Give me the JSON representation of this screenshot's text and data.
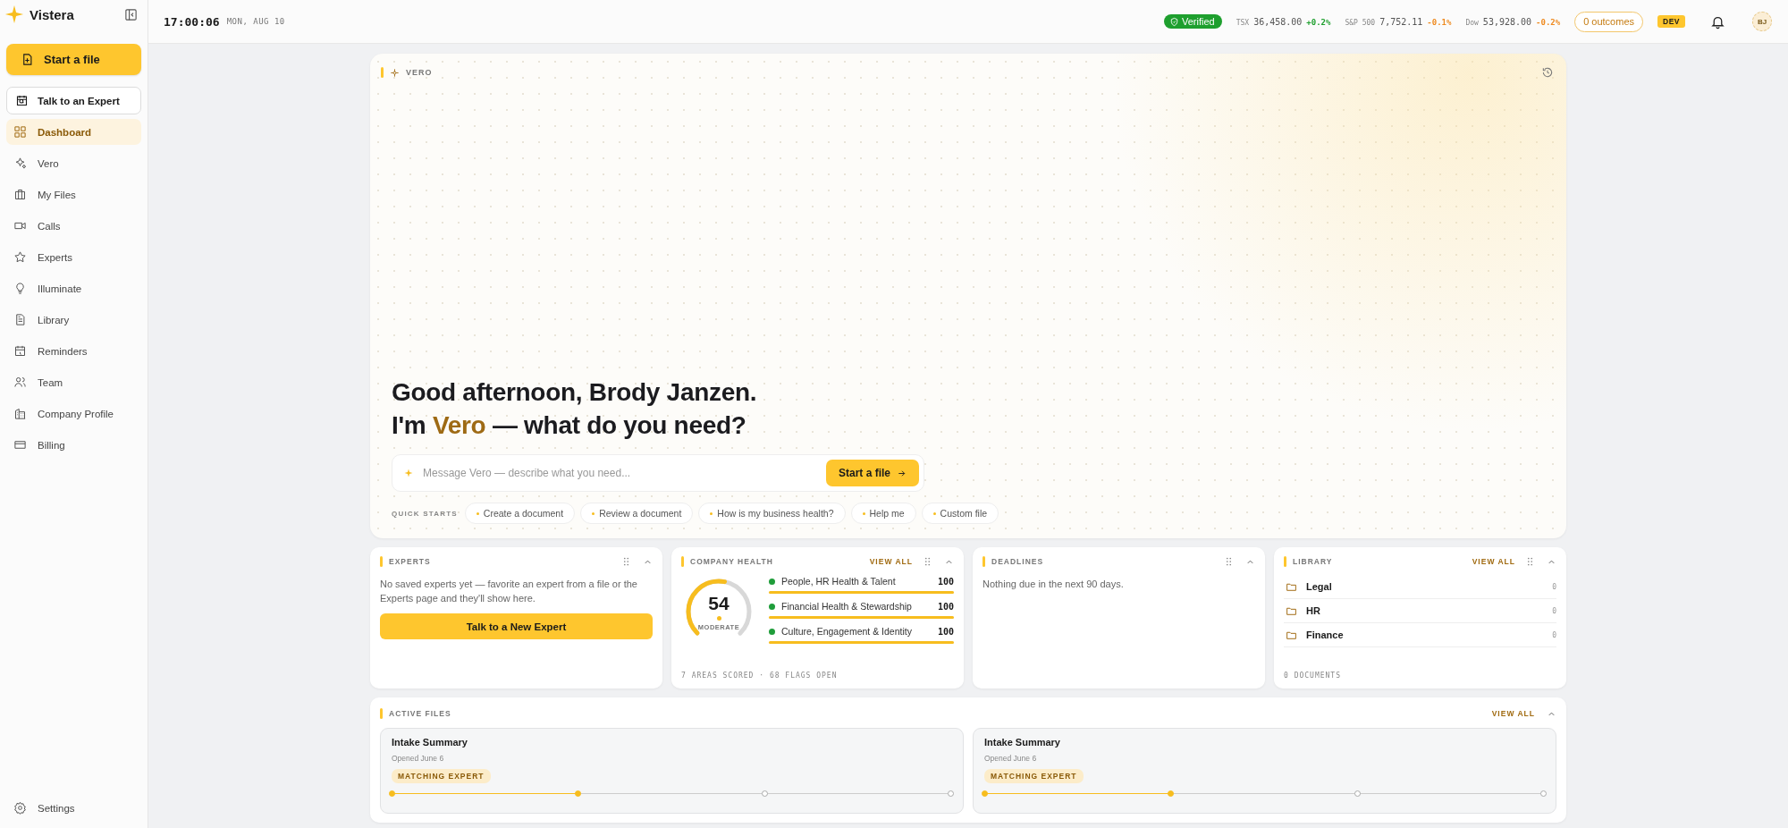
{
  "brand": {
    "name": "Vistera"
  },
  "sidebar": {
    "primary_button": "Start a file",
    "secondary_button": "Talk to an Expert",
    "items": [
      {
        "label": "Dashboard",
        "selected": true
      },
      {
        "label": "Vero",
        "selected": false
      },
      {
        "label": "My Files",
        "selected": false
      },
      {
        "label": "Calls",
        "selected": false
      },
      {
        "label": "Experts",
        "selected": false
      },
      {
        "label": "Illuminate",
        "selected": false
      },
      {
        "label": "Library",
        "selected": false
      },
      {
        "label": "Reminders",
        "selected": false
      },
      {
        "label": "Team",
        "selected": false
      },
      {
        "label": "Company Profile",
        "selected": false
      },
      {
        "label": "Billing",
        "selected": false
      }
    ],
    "footer_item": "Settings"
  },
  "topbar": {
    "time": "17:00:06",
    "date": "MON, AUG 10",
    "verified": "Verified",
    "tickers": [
      {
        "symbol": "TSX",
        "value": "36,458.00",
        "change": "+0.2%",
        "color": "#1e9f2e"
      },
      {
        "symbol": "S&P 500",
        "value": "7,752.11",
        "change": "-0.1%",
        "color": "#ee8a20"
      },
      {
        "symbol": "Dow",
        "value": "53,928.00",
        "change": "-0.2%",
        "color": "#ee8a20"
      }
    ],
    "outcomes": "0 outcomes",
    "env": "DEV",
    "avatar": "BJ"
  },
  "hero": {
    "label": "VERO",
    "greeting": "Good afternoon, Brody Janzen.",
    "prompt_before": "I'm ",
    "prompt_name": "Vero",
    "prompt_after": " — what do you need?",
    "input_placeholder": "Message Vero — describe what you need...",
    "submit": "Start a file",
    "quick_starts_label": "QUICK STARTS",
    "quick_starts": [
      "Create a document",
      "Review a document",
      "How is my business health?",
      "Help me",
      "Custom file"
    ]
  },
  "experts": {
    "title": "EXPERTS",
    "message": "No saved experts yet — favorite an expert from a file or the Experts page and they'll show here.",
    "button": "Talk to a New Expert"
  },
  "company_health": {
    "title": "COMPANY HEALTH",
    "view_all": "VIEW ALL",
    "score": "54",
    "level": 0.54,
    "rating": "MODERATE",
    "areas": [
      {
        "name": "People, HR Health & Talent",
        "score": "100",
        "level": 1,
        "color": "#1f9d3a"
      },
      {
        "name": "Financial Health & Stewardship",
        "score": "100",
        "level": 1,
        "color": "#1f9d3a"
      },
      {
        "name": "Culture, Engagement & Identity",
        "score": "100",
        "level": 1,
        "color": "#1f9d3a"
      }
    ],
    "footer": "7 AREAS SCORED · 68 FLAGS OPEN"
  },
  "deadlines": {
    "title": "DEADLINES",
    "message": "Nothing due in the next 90 days."
  },
  "library": {
    "title": "LIBRARY",
    "view_all": "VIEW ALL",
    "folders": [
      {
        "name": "Legal",
        "count": "0"
      },
      {
        "name": "HR",
        "count": "0"
      },
      {
        "name": "Finance",
        "count": "0"
      }
    ],
    "footer": "0 DOCUMENTS"
  },
  "active_files": {
    "title": "ACTIVE FILES",
    "view_all": "VIEW ALL",
    "files": [
      {
        "title": "Intake Summary",
        "opened": "Opened June 6",
        "status": "MATCHING EXPERT",
        "level": 0.3333
      },
      {
        "title": "Intake Summary",
        "opened": "Opened June 6",
        "status": "MATCHING EXPERT",
        "level": 0.3333
      }
    ]
  }
}
